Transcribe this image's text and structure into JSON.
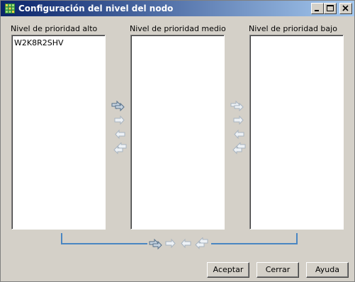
{
  "window": {
    "title": "Configuración del nivel del nodo"
  },
  "columns": {
    "high": {
      "label": "Nivel de prioridad alto",
      "items": [
        "W2K8R2SHV"
      ]
    },
    "medium": {
      "label": "Nivel de prioridad medio",
      "items": []
    },
    "low": {
      "label": "Nivel de prioridad bajo",
      "items": []
    }
  },
  "icons": {
    "move_all_right": "double-arrow-right-icon",
    "move_right": "arrow-right-icon",
    "move_left": "arrow-left-icon",
    "move_all_left": "double-arrow-left-icon"
  },
  "colors": {
    "titlebar_start": "#0a246a",
    "titlebar_end": "#a6caf0",
    "bracket": "#4a86c2"
  },
  "buttons": {
    "accept": "Aceptar",
    "close": "Cerrar",
    "help": "Ayuda"
  }
}
